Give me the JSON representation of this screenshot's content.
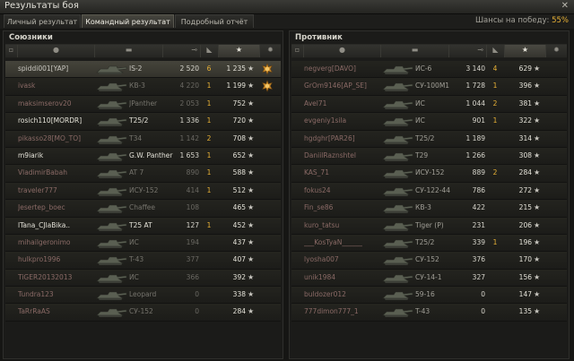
{
  "window": {
    "title": "Результаты боя",
    "close": "✕"
  },
  "tabs": [
    {
      "label": "Личный результат",
      "active": false
    },
    {
      "label": "Командный результат",
      "active": true
    },
    {
      "label": "Подробный отчёт",
      "active": false
    }
  ],
  "chance": {
    "label": "Шансы на победу:",
    "value": "55%"
  },
  "allies": {
    "title": "Союзники",
    "rows": [
      {
        "name": "spiddi001[YAP]",
        "tank": "IS-2",
        "damage": "2 520",
        "kills": "6",
        "xp": "1 235",
        "state": "hl",
        "medal": true
      },
      {
        "name": "ivask",
        "tank": "КВ-3",
        "damage": "4 220",
        "kills": "1",
        "xp": "1 199",
        "state": "dead",
        "medal": true
      },
      {
        "name": "maksimserov20",
        "tank": "JPanther",
        "damage": "2 053",
        "kills": "1",
        "xp": "752",
        "state": "dead",
        "medal": false
      },
      {
        "name": "rosich110[MORDR]",
        "tank": "T25/2",
        "damage": "1 336",
        "kills": "1",
        "xp": "720",
        "state": "alive",
        "medal": false
      },
      {
        "name": "pikasso28[MO_TO]",
        "tank": "T34",
        "damage": "1 142",
        "kills": "2",
        "xp": "708",
        "state": "dead",
        "medal": false
      },
      {
        "name": "m9iarik",
        "tank": "G.W. Panther",
        "damage": "1 653",
        "kills": "1",
        "xp": "652",
        "state": "alive",
        "medal": false
      },
      {
        "name": "VladimirBabah",
        "tank": "AT 7",
        "damage": "890",
        "kills": "1",
        "xp": "588",
        "state": "dead",
        "medal": false
      },
      {
        "name": "traveler777",
        "tank": "ИСУ-152",
        "damage": "414",
        "kills": "1",
        "xp": "512",
        "state": "dead",
        "medal": false
      },
      {
        "name": "Jesertep_boec",
        "tank": "Chaffee",
        "damage": "108",
        "kills": "",
        "xp": "465",
        "state": "dead",
        "medal": false
      },
      {
        "name": "lTana_CJlaBika..",
        "tank": "T25 AT",
        "damage": "127",
        "kills": "1",
        "xp": "452",
        "state": "alive",
        "medal": false
      },
      {
        "name": "mihailgeronimo",
        "tank": "ИС",
        "damage": "194",
        "kills": "",
        "xp": "437",
        "state": "dead",
        "medal": false
      },
      {
        "name": "hulkpro1996",
        "tank": "T-43",
        "damage": "377",
        "kills": "",
        "xp": "407",
        "state": "dead",
        "medal": false
      },
      {
        "name": "TiGER20132013",
        "tank": "ИС",
        "damage": "366",
        "kills": "",
        "xp": "392",
        "state": "dead",
        "medal": false
      },
      {
        "name": "Tundra123",
        "tank": "Leopard",
        "damage": "0",
        "kills": "",
        "xp": "338",
        "state": "dead",
        "medal": false
      },
      {
        "name": "TaRrRaAS",
        "tank": "СУ-152",
        "damage": "0",
        "kills": "",
        "xp": "284",
        "state": "dead",
        "medal": false
      }
    ]
  },
  "enemies": {
    "title": "Противник",
    "rows": [
      {
        "name": "negverg[DAVO]",
        "tank": "ИС-6",
        "damage": "3 140",
        "kills": "4",
        "xp": "629"
      },
      {
        "name": "GrOm9146[AP_SE]",
        "tank": "СУ-100М1",
        "damage": "1 728",
        "kills": "1",
        "xp": "396"
      },
      {
        "name": "Avel71",
        "tank": "ИС",
        "damage": "1 044",
        "kills": "2",
        "xp": "381"
      },
      {
        "name": "evgeniy1sila",
        "tank": "ИС",
        "damage": "901",
        "kills": "1",
        "xp": "322"
      },
      {
        "name": "hgdghr[PAR26]",
        "tank": "T25/2",
        "damage": "1 189",
        "kills": "",
        "xp": "314"
      },
      {
        "name": "DaniilRaznshtel",
        "tank": "T29",
        "damage": "1 266",
        "kills": "",
        "xp": "308"
      },
      {
        "name": "KAS_71",
        "tank": "ИСУ-152",
        "damage": "889",
        "kills": "2",
        "xp": "284"
      },
      {
        "name": "fokus24",
        "tank": "СУ-122-44",
        "damage": "786",
        "kills": "",
        "xp": "272"
      },
      {
        "name": "Fin_se86",
        "tank": "КВ-3",
        "damage": "422",
        "kills": "",
        "xp": "215"
      },
      {
        "name": "kuro_tatsu",
        "tank": "Tiger (P)",
        "damage": "231",
        "kills": "",
        "xp": "206"
      },
      {
        "name": "___KosTyaN______",
        "tank": "T25/2",
        "damage": "339",
        "kills": "1",
        "xp": "196"
      },
      {
        "name": "lyosha007",
        "tank": "СУ-152",
        "damage": "376",
        "kills": "",
        "xp": "170"
      },
      {
        "name": "unik1984",
        "tank": "СУ-14-1",
        "damage": "327",
        "kills": "",
        "xp": "156"
      },
      {
        "name": "buldozer012",
        "tank": "59-16",
        "damage": "0",
        "kills": "",
        "xp": "147"
      },
      {
        "name": "777dimon777_1",
        "tank": "T-43",
        "damage": "0",
        "kills": "",
        "xp": "135"
      }
    ]
  },
  "icons": {
    "star": "★",
    "medal": "medal-icon",
    "tank": "tank-silhouette-icon"
  }
}
